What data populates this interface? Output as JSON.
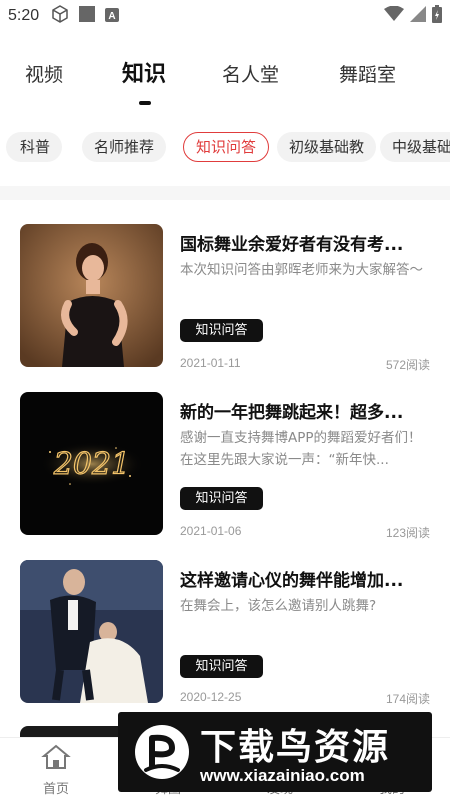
{
  "status_bar": {
    "time": "5:20",
    "app_badge": "A"
  },
  "top_tabs": [
    {
      "label": "视频"
    },
    {
      "label": "知识",
      "active": true
    },
    {
      "label": "名人堂"
    },
    {
      "label": "舞蹈室"
    }
  ],
  "chips": [
    {
      "label": "科普"
    },
    {
      "label": "名师推荐"
    },
    {
      "label": "知识问答",
      "active": true
    },
    {
      "label": "初级基础教"
    },
    {
      "label": "中级基础"
    }
  ],
  "articles": [
    {
      "title": "国标舞业余爱好者有没有考...",
      "desc": "本次知识问答由郭晖老师来为大家解答～",
      "tag": "知识问答",
      "date": "2021-01-11",
      "reads": "572阅读"
    },
    {
      "title": "新的一年把舞跳起来！超多...",
      "desc": "感谢一直支持舞博APP的舞蹈爱好者们！在这里先跟大家说一声：“新年快...",
      "tag": "知识问答",
      "date": "2021-01-06",
      "reads": "123阅读",
      "image_text": "2021"
    },
    {
      "title": "这样邀请心仪的舞伴能增加...",
      "desc": "在舞会上，该怎么邀请别人跳舞?",
      "tag": "知识问答",
      "date": "2020-12-25",
      "reads": "174阅读"
    }
  ],
  "bottom_nav": [
    {
      "label": "首页",
      "icon": "home-icon"
    },
    {
      "label": "舞圈",
      "icon": "circle-icon"
    },
    {
      "label": "发现",
      "icon": "discover-icon"
    },
    {
      "label": "我的",
      "icon": "profile-icon"
    }
  ],
  "watermark": {
    "title": "下载鸟资源",
    "url": "www.xiazainiao.com"
  },
  "colors": {
    "accent": "#e03c3c",
    "tag_bg": "#111111"
  }
}
